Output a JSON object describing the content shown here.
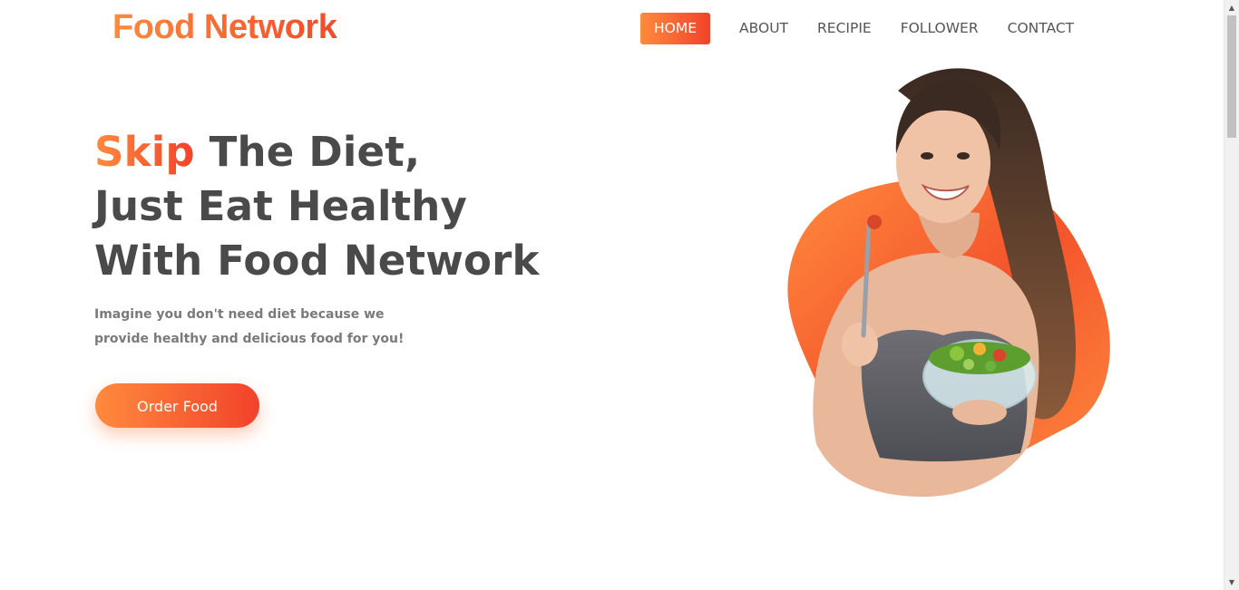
{
  "header": {
    "logo_text": "Food Network",
    "nav": [
      {
        "label": "HOME",
        "active": true
      },
      {
        "label": "ABOUT",
        "active": false
      },
      {
        "label": "RECIPIE",
        "active": false
      },
      {
        "label": "FOLLOWER",
        "active": false
      },
      {
        "label": "CONTACT",
        "active": false
      }
    ]
  },
  "hero": {
    "title_accent": "Skip",
    "title_line1_rest": " The Diet,",
    "title_line2": "Just Eat Healthy",
    "title_line3": "With Food Network",
    "subtitle": "Imagine you don't need diet because we provide healthy and delicious food for you!",
    "cta_label": "Order Food",
    "image_icon": "woman-eating-salad-image"
  },
  "colors": {
    "accent_start": "#ff8a3d",
    "accent_end": "#f2422b",
    "heading": "#4a4a4a",
    "body_text": "#7a7a7a"
  },
  "scrollbar": {
    "up_icon": "scroll-up-arrow-icon",
    "down_icon": "scroll-down-arrow-icon"
  }
}
